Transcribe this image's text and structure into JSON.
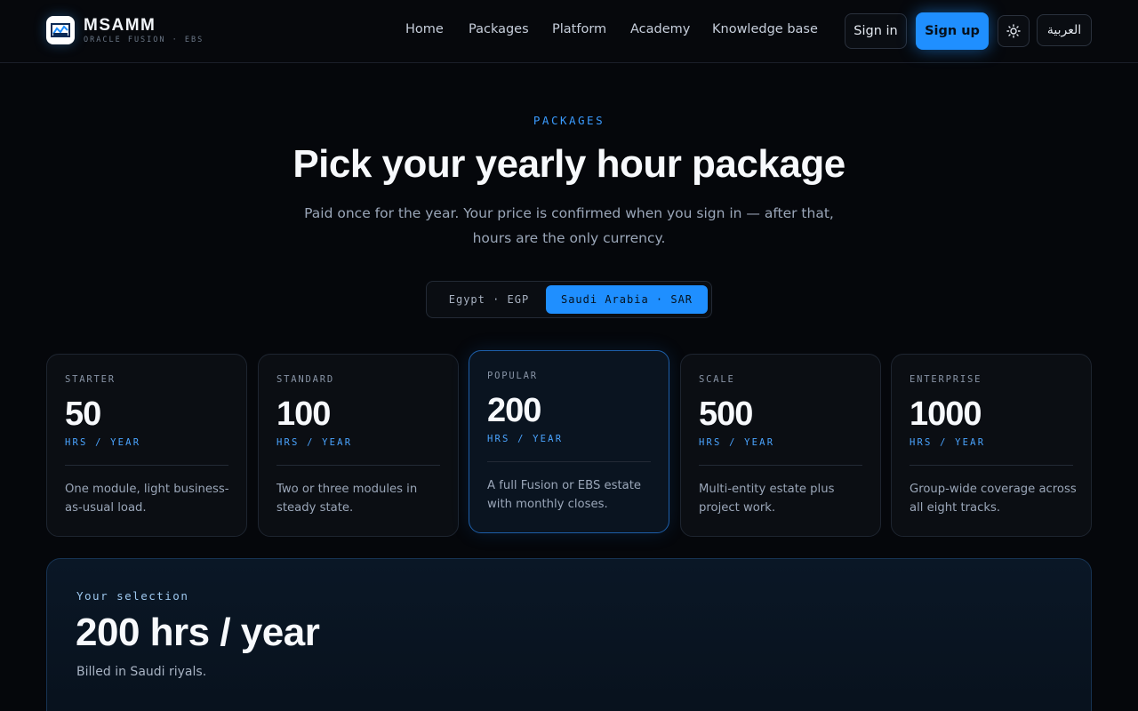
{
  "brand": {
    "name": "MSAMM",
    "tagline": "ORACLE FUSION · EBS",
    "logo_icon": "chart-logo-icon"
  },
  "nav": {
    "items": [
      {
        "label": "Home"
      },
      {
        "label": "Packages"
      },
      {
        "label": "Platform"
      },
      {
        "label": "Academy"
      },
      {
        "label": "Knowledge base"
      }
    ]
  },
  "actions": {
    "signin_label": "Sign in",
    "signup_label": "Sign up",
    "theme_icon": "sun-icon",
    "language_label": "العربية"
  },
  "hero": {
    "eyebrow": "PACKAGES",
    "title": "Pick your yearly hour package",
    "subtitle": "Paid once for the year. Your price is confirmed when you sign in — after that, hours are the only currency."
  },
  "currency_toggle": {
    "options": [
      {
        "label": "Egypt · EGP",
        "selected": false
      },
      {
        "label": "Saudi Arabia · SAR",
        "selected": true
      }
    ]
  },
  "packages": [
    {
      "tier": "STARTER",
      "hours": "50",
      "unit": "HRS / YEAR",
      "description": "One module, light business-as-usual load.",
      "selected": false
    },
    {
      "tier": "STANDARD",
      "hours": "100",
      "unit": "HRS / YEAR",
      "description": "Two or three modules in steady state.",
      "selected": false
    },
    {
      "tier": "POPULAR",
      "hours": "200",
      "unit": "HRS / YEAR",
      "description": "A full Fusion or EBS estate with monthly closes.",
      "selected": true
    },
    {
      "tier": "SCALE",
      "hours": "500",
      "unit": "HRS / YEAR",
      "description": "Multi-entity estate plus project work.",
      "selected": false
    },
    {
      "tier": "ENTERPRISE",
      "hours": "1000",
      "unit": "HRS / YEAR",
      "description": "Group-wide coverage across all eight tracks.",
      "selected": false
    }
  ],
  "selection": {
    "label": "Your selection",
    "value": "200 hrs / year",
    "note": "Billed in Saudi riyals."
  },
  "colors": {
    "accent": "#1f8fff",
    "background": "#05070b",
    "card_background": "#0b0e13",
    "popular_border": "#1d5ea8"
  }
}
